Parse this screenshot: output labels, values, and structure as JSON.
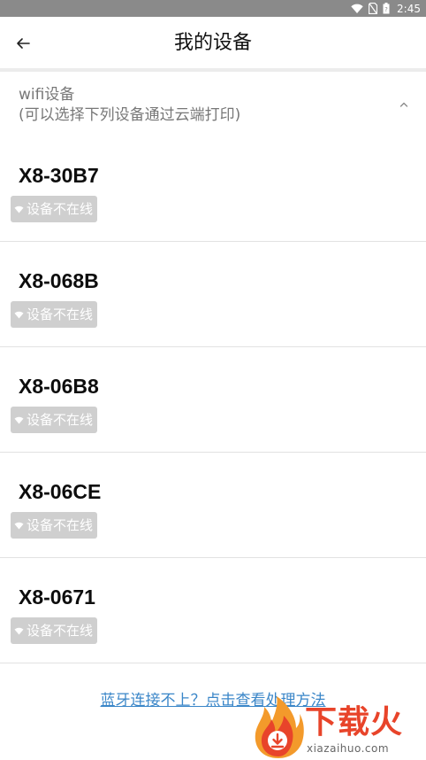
{
  "status_bar": {
    "time": "2:45",
    "icons": [
      "wifi-icon",
      "no-sim-icon",
      "battery-icon"
    ]
  },
  "app_bar": {
    "back_icon": "back-arrow-icon",
    "title": "我的设备"
  },
  "section": {
    "title": "wifi设备",
    "subtitle": "(可以选择下列设备通过云端打印)",
    "toggle_icon": "chevron-up-icon",
    "expanded": true
  },
  "devices": [
    {
      "name": "X8-30B7",
      "status": "设备不在线"
    },
    {
      "name": "X8-068B",
      "status": "设备不在线"
    },
    {
      "name": "X8-06B8",
      "status": "设备不在线"
    },
    {
      "name": "X8-06CE",
      "status": "设备不在线"
    },
    {
      "name": "X8-0671",
      "status": "设备不在线"
    }
  ],
  "help_link": "蓝牙连接不上？点击查看处理方法",
  "watermark": {
    "name": "下载火",
    "domain": "xiazaihuo.com"
  },
  "colors": {
    "status_bar_bg": "#8a8a8a",
    "badge_bg": "#cfcfcf",
    "link": "#3a86c8",
    "watermark_red": "#e8442a",
    "watermark_orange": "#f39a2b"
  }
}
